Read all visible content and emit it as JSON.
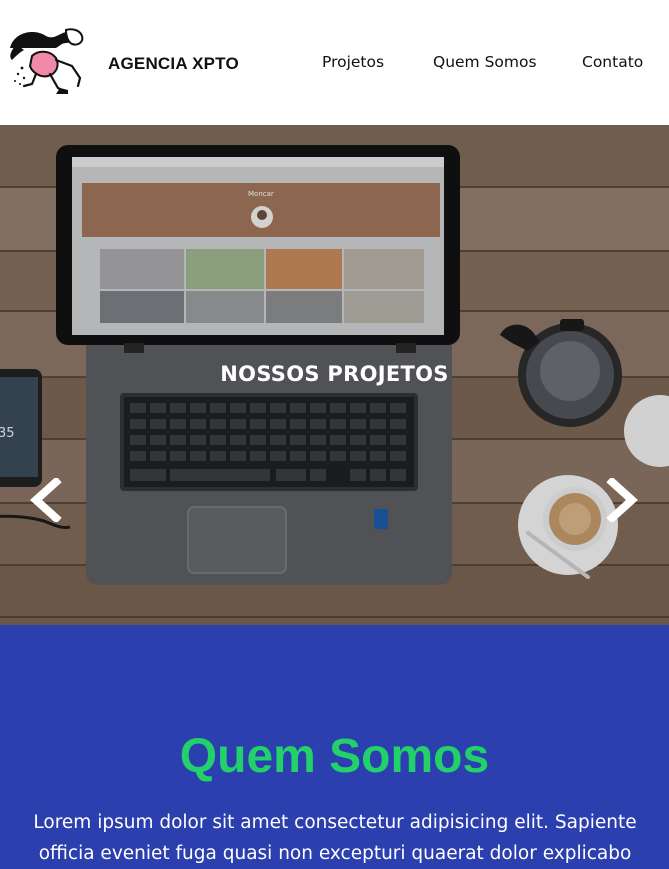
{
  "header": {
    "brand": "AGENCIA XPTO",
    "logo_icon": "person-with-megaphone-illustration",
    "nav": [
      {
        "label": "Projetos"
      },
      {
        "label": "Quem Somos"
      },
      {
        "label": "Contato"
      }
    ]
  },
  "hero": {
    "title": "NOSSOS PROJETOS",
    "prev_icon": "chevron-left-icon",
    "next_icon": "chevron-right-icon",
    "laptop_screen": {
      "site_name": "Moncar",
      "phone_clock": "35"
    }
  },
  "about": {
    "title": "Quem Somos",
    "text": "Lorem ipsum dolor sit amet consectetur adipisicing elit. Sapiente officia eveniet fuga quasi non excepturi quaerat dolor explicabo"
  },
  "colors": {
    "about_bg": "#2b3fae",
    "about_title": "#22d16a",
    "header_bg": "#ffffff"
  }
}
